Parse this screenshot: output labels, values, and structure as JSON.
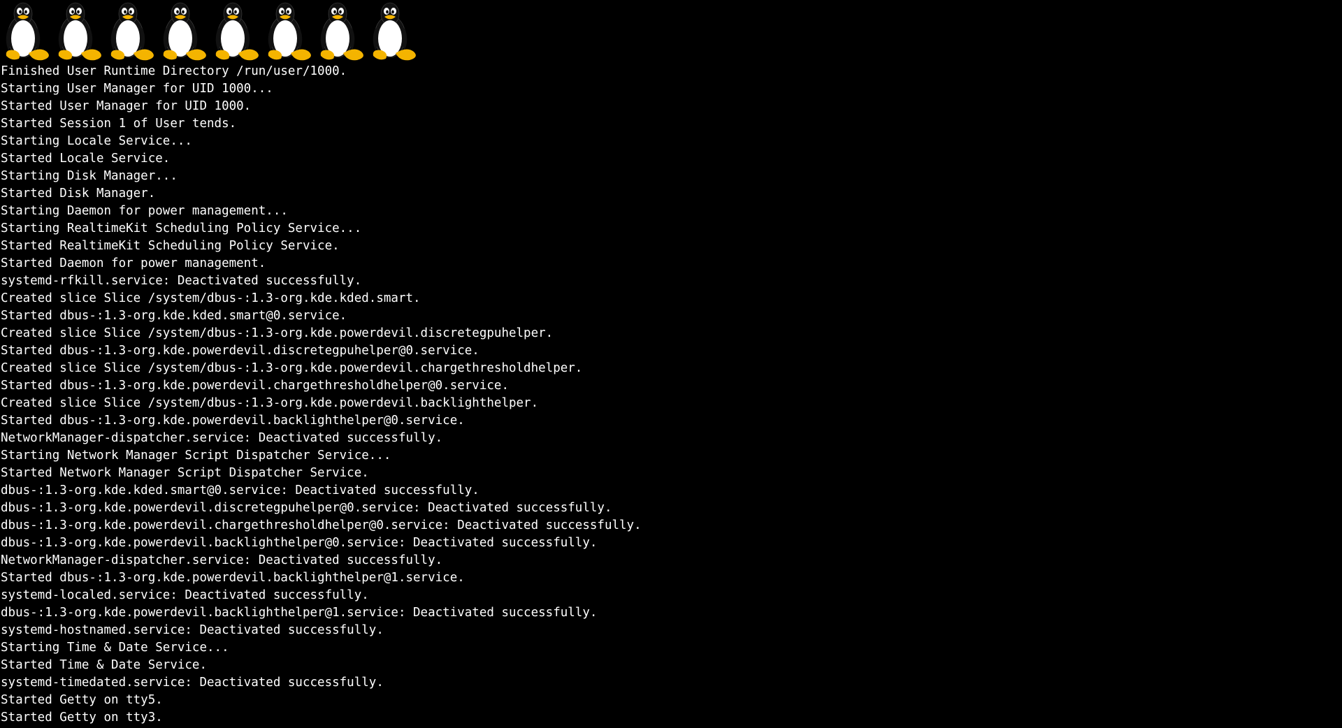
{
  "boot_logo": {
    "icon": "tux-penguin-icon",
    "count": 8,
    "colors": {
      "body": "#111111",
      "belly": "#ffffff",
      "beak_feet": "#f4b400"
    }
  },
  "console": {
    "background": "#000000",
    "foreground": "#ffffff",
    "lines": [
      "Finished User Runtime Directory /run/user/1000.",
      "Starting User Manager for UID 1000...",
      "Started User Manager for UID 1000.",
      "Started Session 1 of User tends.",
      "Starting Locale Service...",
      "Started Locale Service.",
      "Starting Disk Manager...",
      "Started Disk Manager.",
      "Starting Daemon for power management...",
      "Starting RealtimeKit Scheduling Policy Service...",
      "Started RealtimeKit Scheduling Policy Service.",
      "Started Daemon for power management.",
      "systemd-rfkill.service: Deactivated successfully.",
      "Created slice Slice /system/dbus-:1.3-org.kde.kded.smart.",
      "Started dbus-:1.3-org.kde.kded.smart@0.service.",
      "Created slice Slice /system/dbus-:1.3-org.kde.powerdevil.discretegpuhelper.",
      "Started dbus-:1.3-org.kde.powerdevil.discretegpuhelper@0.service.",
      "Created slice Slice /system/dbus-:1.3-org.kde.powerdevil.chargethresholdhelper.",
      "Started dbus-:1.3-org.kde.powerdevil.chargethresholdhelper@0.service.",
      "Created slice Slice /system/dbus-:1.3-org.kde.powerdevil.backlighthelper.",
      "Started dbus-:1.3-org.kde.powerdevil.backlighthelper@0.service.",
      "NetworkManager-dispatcher.service: Deactivated successfully.",
      "Starting Network Manager Script Dispatcher Service...",
      "Started Network Manager Script Dispatcher Service.",
      "dbus-:1.3-org.kde.kded.smart@0.service: Deactivated successfully.",
      "dbus-:1.3-org.kde.powerdevil.discretegpuhelper@0.service: Deactivated successfully.",
      "dbus-:1.3-org.kde.powerdevil.chargethresholdhelper@0.service: Deactivated successfully.",
      "dbus-:1.3-org.kde.powerdevil.backlighthelper@0.service: Deactivated successfully.",
      "NetworkManager-dispatcher.service: Deactivated successfully.",
      "Started dbus-:1.3-org.kde.powerdevil.backlighthelper@1.service.",
      "systemd-localed.service: Deactivated successfully.",
      "dbus-:1.3-org.kde.powerdevil.backlighthelper@1.service: Deactivated successfully.",
      "systemd-hostnamed.service: Deactivated successfully.",
      "Starting Time & Date Service...",
      "Started Time & Date Service.",
      "systemd-timedated.service: Deactivated successfully.",
      "Started Getty on tty5.",
      "Started Getty on tty3."
    ]
  }
}
